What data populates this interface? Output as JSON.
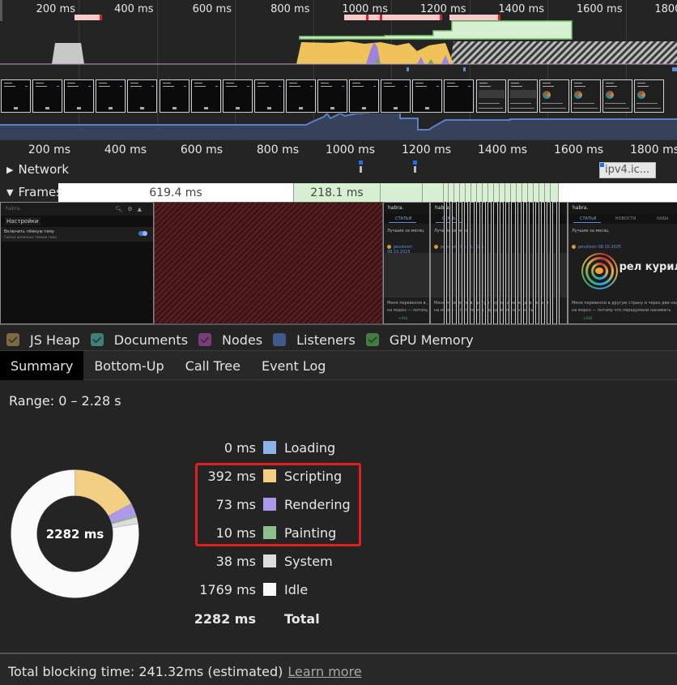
{
  "overview": {
    "tick_labels": [
      "200 ms",
      "400 ms",
      "600 ms",
      "800 ms",
      "1000 ms",
      "1200 ms",
      "1400 ms",
      "1600 ms",
      "1800 ms"
    ],
    "long_tasks_ms": [
      [
        190,
        260
      ],
      [
        880,
        1130
      ],
      [
        1150,
        1280
      ]
    ],
    "network_requests_ms": [
      [
        1040,
        1045
      ],
      [
        1185,
        1190
      ],
      [
        1720,
        1880
      ]
    ],
    "filmstrip_frames": 21
  },
  "timeline": {
    "tick_labels": [
      "200 ms",
      "400 ms",
      "600 ms",
      "800 ms",
      "1000 ms",
      "1200 ms",
      "1400 ms",
      "1600 ms",
      "1800 ms"
    ],
    "tracks": {
      "network": {
        "label": "Network",
        "expanded": false,
        "request_pill": "ipv4.ic..."
      },
      "frames": {
        "label": "Frames",
        "expanded": true,
        "segments": [
          {
            "label": "619.4 ms",
            "type": "idle"
          },
          {
            "label": "218.1 ms",
            "type": "green"
          }
        ]
      }
    },
    "screenshots": {
      "settings_screen": {
        "site": "habra.",
        "title": "Настройки",
        "row_title": "Включить тёмную тему",
        "row_subtitle": "Сейчас включена тёмная тема"
      },
      "article_screen": {
        "site": "habra.",
        "tabs": [
          "СТАТЬИ",
          "НОВОСТИ",
          "ХАБЫ"
        ],
        "subheading": "Лучшие за месяц",
        "author": "pevolvon 08.10.2025",
        "headline": "рел курил",
        "excerpt_1": "Меня перевезли в другую страну и через две недели",
        "excerpt_2": "на мороз — потому что передумали нанимать",
        "karma": "+416"
      }
    }
  },
  "counters": [
    {
      "label": "JS Heap",
      "color": "#7d6a40",
      "checked": true
    },
    {
      "label": "Documents",
      "color": "#3f7f7a",
      "checked": true
    },
    {
      "label": "Nodes",
      "color": "#7a3d7a",
      "checked": true
    },
    {
      "label": "Listeners",
      "color": "#3f5a8a",
      "checked": false
    },
    {
      "label": "GPU Memory",
      "color": "#3f7f3f",
      "checked": true
    }
  ],
  "tabs": [
    {
      "label": "Summary",
      "active": true
    },
    {
      "label": "Bottom-Up",
      "active": false
    },
    {
      "label": "Call Tree",
      "active": false
    },
    {
      "label": "Event Log",
      "active": false
    }
  ],
  "summary": {
    "range": "Range: 0 – 2.28 s",
    "total_center": "2282 ms"
  },
  "chart_data": {
    "type": "pie",
    "title": "2282 ms",
    "categories": [
      "Loading",
      "Scripting",
      "Rendering",
      "Painting",
      "System",
      "Idle"
    ],
    "values": [
      0,
      392,
      73,
      10,
      38,
      1769
    ],
    "value_labels": [
      "0 ms",
      "392 ms",
      "73 ms",
      "10 ms",
      "38 ms",
      "1769 ms"
    ],
    "colors": [
      "#8bb4e8",
      "#f2cf82",
      "#ad99ea",
      "#8cc08a",
      "#dddddd",
      "#fafafa"
    ],
    "total": {
      "label": "Total",
      "value": 2282,
      "value_label": "2282 ms"
    },
    "donut": true,
    "legend_placement": "right",
    "highlighted": [
      "Scripting",
      "Rendering",
      "Painting"
    ]
  },
  "footer": {
    "text": "Total blocking time: 241.32ms (estimated)",
    "link": "Learn more"
  }
}
